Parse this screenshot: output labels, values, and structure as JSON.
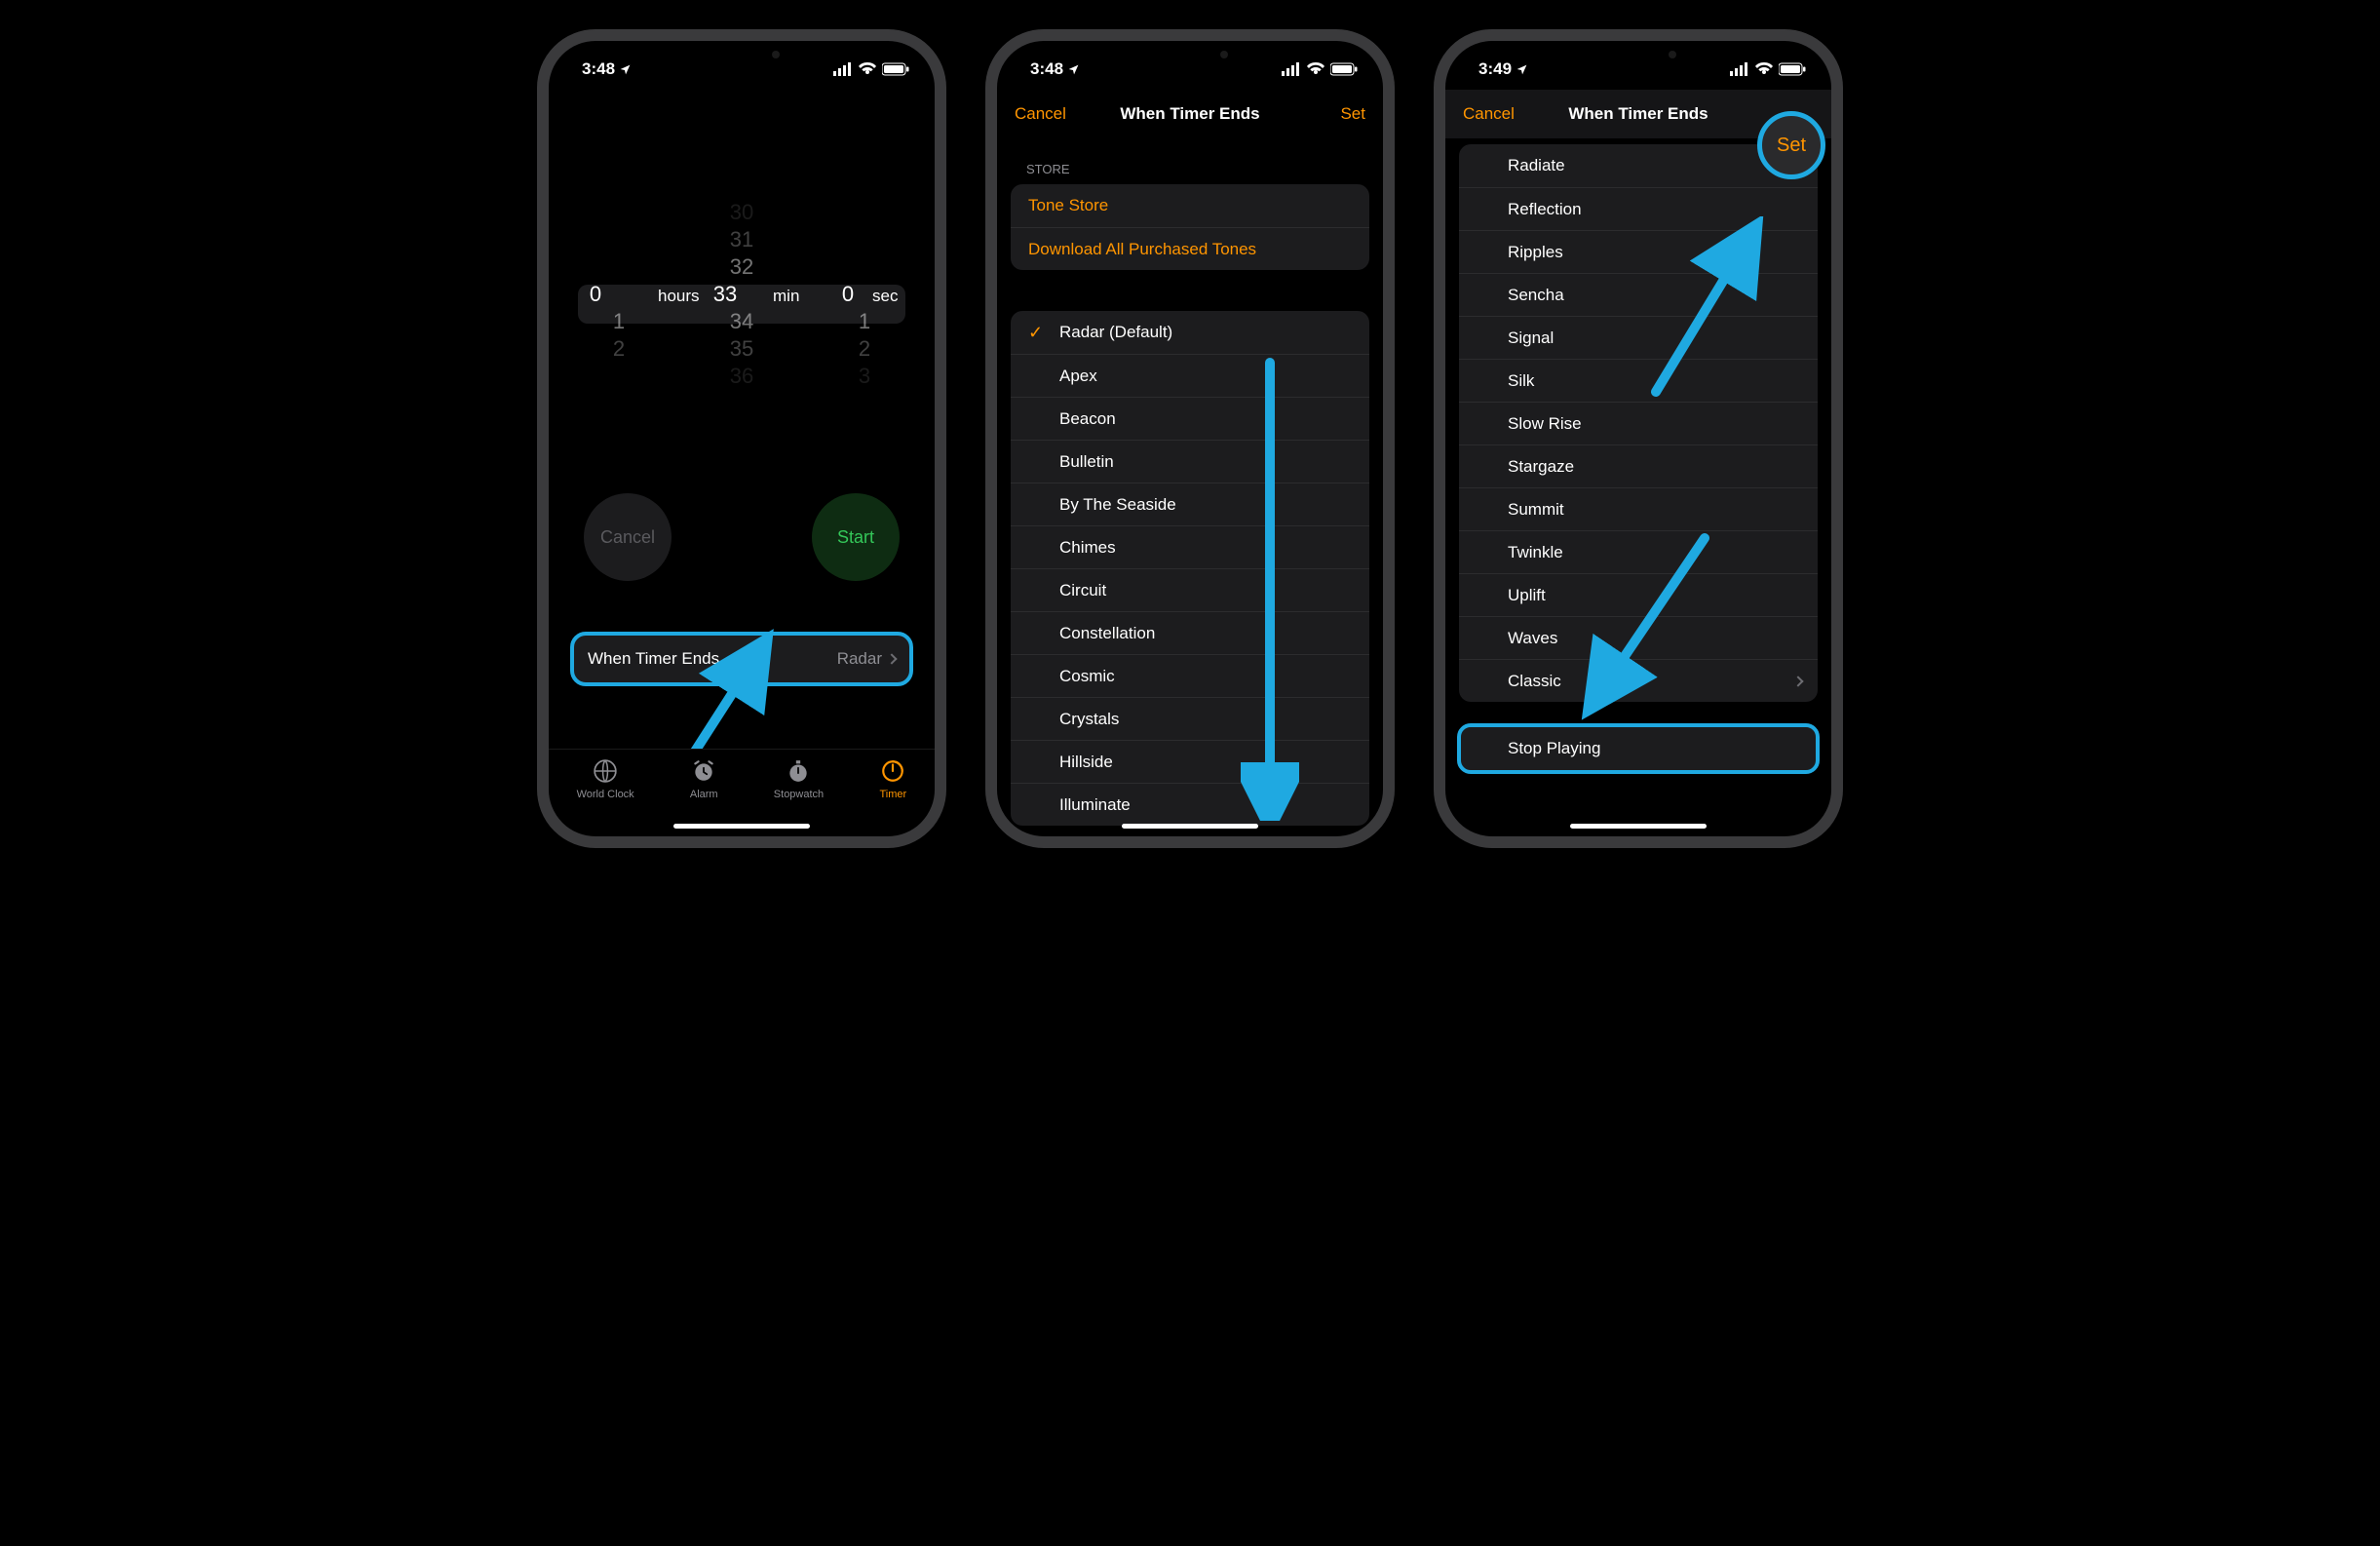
{
  "status": {
    "time1": "3:48",
    "time2": "3:48",
    "time3": "3:49"
  },
  "phone1": {
    "picker": {
      "hours_sel": "0",
      "min_sel": "33",
      "sec_sel": "0",
      "unit_hours": "hours",
      "unit_min": "min",
      "unit_sec": "sec",
      "hours_below": [
        "1",
        "2"
      ],
      "min_above": [
        "30",
        "31",
        "32"
      ],
      "min_below": [
        "34",
        "35",
        "36"
      ],
      "sec_below": [
        "1",
        "2",
        "3"
      ]
    },
    "cancel": "Cancel",
    "start": "Start",
    "wte_label": "When Timer Ends",
    "wte_value": "Radar",
    "tabs": {
      "world": "World Clock",
      "alarm": "Alarm",
      "stopwatch": "Stopwatch",
      "timer": "Timer"
    }
  },
  "phone2": {
    "nav": {
      "cancel": "Cancel",
      "title": "When Timer Ends",
      "set": "Set"
    },
    "store_header": "STORE",
    "store": {
      "tone_store": "Tone Store",
      "download": "Download All Purchased Tones"
    },
    "tones": [
      "Radar (Default)",
      "Apex",
      "Beacon",
      "Bulletin",
      "By The Seaside",
      "Chimes",
      "Circuit",
      "Constellation",
      "Cosmic",
      "Crystals",
      "Hillside",
      "Illuminate"
    ]
  },
  "phone3": {
    "nav": {
      "cancel": "Cancel",
      "title": "When Timer Ends",
      "set": "Set"
    },
    "tones": [
      "Radiate",
      "Reflection",
      "Ripples",
      "Sencha",
      "Signal",
      "Silk",
      "Slow Rise",
      "Stargaze",
      "Summit",
      "Twinkle",
      "Uplift",
      "Waves",
      "Classic"
    ],
    "stop": "Stop Playing"
  }
}
